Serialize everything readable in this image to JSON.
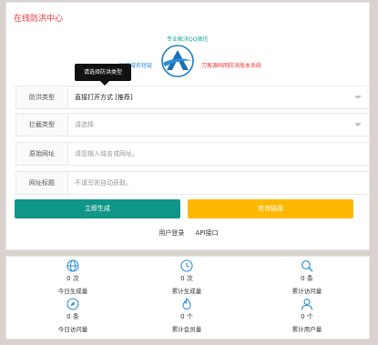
{
  "header": {
    "title": "在线防洪中心"
  },
  "promo": {
    "qq": "专业解决QQ微信",
    "site_code": "同源域名短链",
    "system": "刀客源码网防洪版本系统"
  },
  "tooltip": "请选择防洪类型",
  "form": {
    "type": {
      "label": "防洪类型",
      "value": "直接打开方式 [推荐]"
    },
    "intercept": {
      "label": "拦截类型",
      "value": "请选择"
    },
    "url": {
      "label": "原始网址",
      "placeholder": "请您输入域名或网址。"
    },
    "web_title": {
      "label": "网址标题",
      "placeholder": "不填写则自动获取。"
    }
  },
  "buttons": {
    "generate": "立即生成",
    "query": "查询链接"
  },
  "links": {
    "login": "用户登录",
    "api": "API接口"
  },
  "stats": [
    {
      "icon": "globe-icon",
      "value": "0 次",
      "label": "今日生成量"
    },
    {
      "icon": "clock-icon",
      "value": "0 次",
      "label": "累计生成量"
    },
    {
      "icon": "search-icon",
      "value": "0 条",
      "label": "累计访问量"
    },
    {
      "icon": "compass-icon",
      "value": "0 条",
      "label": "今日访问量"
    },
    {
      "icon": "fire-icon",
      "value": "0 个",
      "label": "累计会员量"
    },
    {
      "icon": "user-icon",
      "value": "0 个",
      "label": "累计用户量"
    }
  ],
  "colors": {
    "title": "#e8343b",
    "primary": "#0f9688",
    "warning": "#ffb800",
    "icon": "#2a8ed8"
  }
}
